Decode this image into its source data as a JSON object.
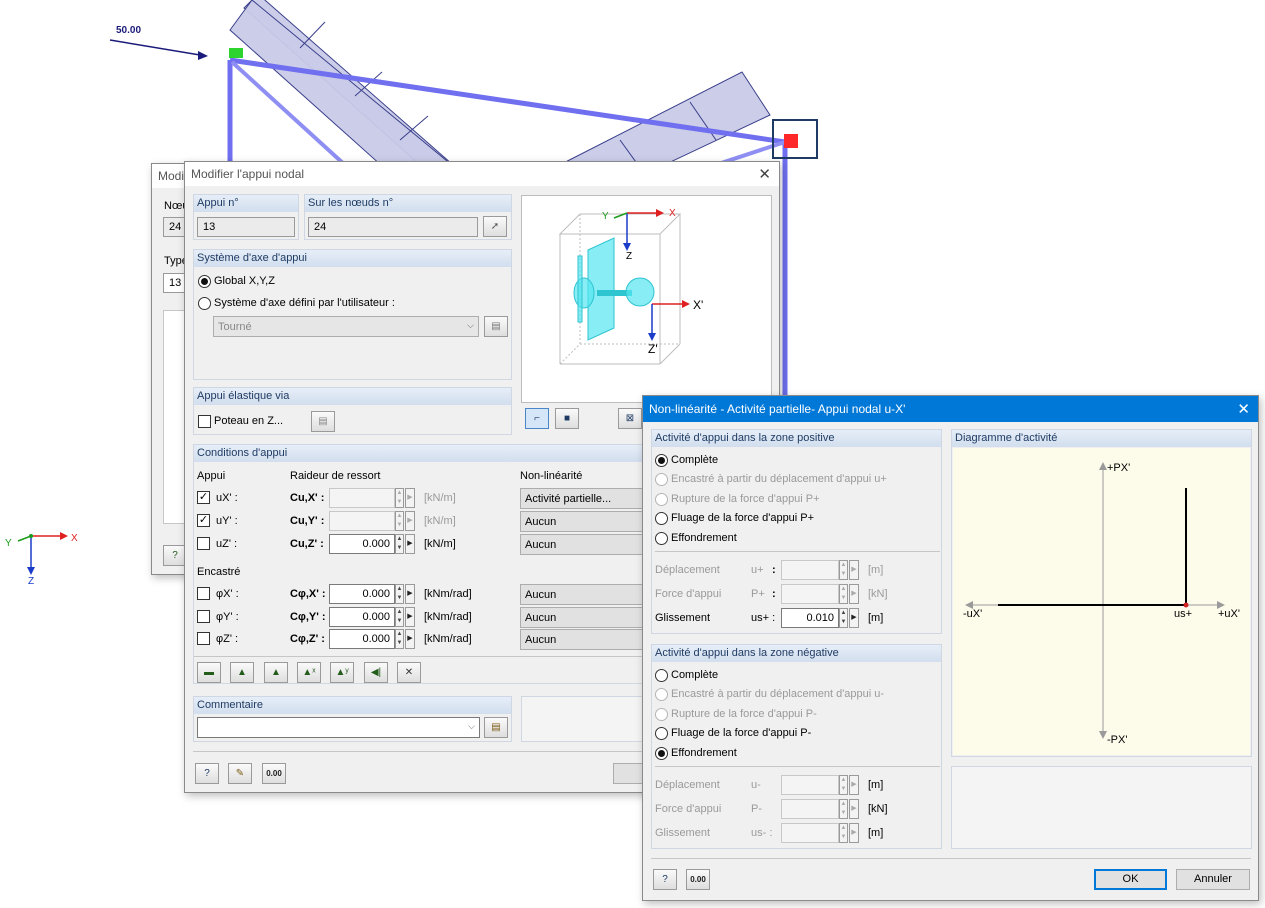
{
  "viewport": {
    "load_label": "50.00",
    "axis_y": "Y",
    "axis_x": "X",
    "axis_z": "Z"
  },
  "back_dialog": {
    "title_partial": "Modi",
    "label_node": "Nœu",
    "value_node": "24",
    "label_type": "Type",
    "value_type": "13"
  },
  "support_dialog": {
    "title": "Modifier l'appui nodal",
    "support_no": {
      "label": "Appui n°",
      "value": "13"
    },
    "on_nodes": {
      "label": "Sur les nœuds n°",
      "value": "24"
    },
    "axis_system": {
      "label": "Système d'axe d'appui",
      "option_global": "Global X,Y,Z",
      "option_user": "Système d'axe défini par l'utilisateur :",
      "rotated_value": "Tourné"
    },
    "preview": {
      "axis_x": "X",
      "axis_y": "Y",
      "axis_z": "Z",
      "axis_x_local": "X'",
      "axis_z_local": "Z'"
    },
    "elastic": {
      "label": "Appui élastique via",
      "column_label": "Poteau en Z..."
    },
    "conditions": {
      "label": "Conditions d'appui",
      "col_support": "Appui",
      "col_spring": "Raideur de ressort",
      "col_nonlin": "Non-linéarité",
      "rows": [
        {
          "checked": true,
          "name": "uX' :",
          "sym": "Cu,X' :",
          "value": "",
          "unit": "[kN/m]",
          "nonlin": "Activité partielle...",
          "enabled": false
        },
        {
          "checked": true,
          "name": "uY' :",
          "sym": "Cu,Y' :",
          "value": "",
          "unit": "[kN/m]",
          "nonlin": "Aucun",
          "enabled": false
        },
        {
          "checked": false,
          "name": "uZ' :",
          "sym": "Cu,Z' :",
          "value": "0.000",
          "unit": "[kN/m]",
          "nonlin": "Aucun",
          "enabled": true
        }
      ],
      "fixed_label": "Encastré",
      "rot_rows": [
        {
          "checked": false,
          "name": "φX' :",
          "sym": "Cφ,X' :",
          "value": "0.000",
          "unit": "[kNm/rad]",
          "nonlin": "Aucun"
        },
        {
          "checked": false,
          "name": "φY' :",
          "sym": "Cφ,Y' :",
          "value": "0.000",
          "unit": "[kNm/rad]",
          "nonlin": "Aucun"
        },
        {
          "checked": false,
          "name": "φZ' :",
          "sym": "Cφ,Z' :",
          "value": "0.000",
          "unit": "[kNm/rad]",
          "nonlin": "Aucun"
        }
      ]
    },
    "comment": {
      "label": "Commentaire",
      "value": ""
    },
    "footer_value_icon": "0.00"
  },
  "nonlin_dialog": {
    "title": "Non-linéarité - Activité partielle- Appui nodal u-X'",
    "positive": {
      "label": "Activité d'appui dans la zone positive",
      "options": [
        {
          "text": "Complète",
          "selected": true,
          "enabled": true
        },
        {
          "text": "Encastré à partir du déplacement d'appui u+",
          "selected": false,
          "enabled": false
        },
        {
          "text": "Rupture de la force d'appui P+",
          "selected": false,
          "enabled": false
        },
        {
          "text": "Fluage de la force d'appui P+",
          "selected": false,
          "enabled": true
        },
        {
          "text": "Effondrement",
          "selected": false,
          "enabled": true
        }
      ],
      "fields": [
        {
          "label": "Déplacement",
          "sym": "u+",
          "value": "",
          "unit": "[m]",
          "enabled": false
        },
        {
          "label": "Force d'appui",
          "sym": "P+",
          "value": "",
          "unit": "[kN]",
          "enabled": false
        },
        {
          "label": "Glissement",
          "sym": "us+ :",
          "value": "0.010",
          "unit": "[m]",
          "enabled": true
        }
      ]
    },
    "negative": {
      "label": "Activité d'appui dans la zone négative",
      "options": [
        {
          "text": "Complète",
          "selected": false,
          "enabled": true
        },
        {
          "text": "Encastré à partir du déplacement d'appui u-",
          "selected": false,
          "enabled": false
        },
        {
          "text": "Rupture de la force d'appui P-",
          "selected": false,
          "enabled": false
        },
        {
          "text": "Fluage de la force d'appui P-",
          "selected": false,
          "enabled": true
        },
        {
          "text": "Effondrement",
          "selected": true,
          "enabled": true
        }
      ],
      "fields": [
        {
          "label": "Déplacement",
          "sym": "u-",
          "value": "",
          "unit": "[m]",
          "enabled": false
        },
        {
          "label": "Force d'appui",
          "sym": "P-",
          "value": "",
          "unit": "[kN]",
          "enabled": false
        },
        {
          "label": "Glissement",
          "sym": "us- :",
          "value": "",
          "unit": "[m]",
          "enabled": false
        }
      ]
    },
    "diagram": {
      "label": "Diagramme d'activité",
      "p_pos": "+PX'",
      "p_neg": "-PX'",
      "u_neg": "-uX'",
      "u_pos": "+uX'",
      "us_label": "us+"
    },
    "ok_label": "OK",
    "cancel_label": "Annuler",
    "footer_value_icon": "0.00"
  }
}
